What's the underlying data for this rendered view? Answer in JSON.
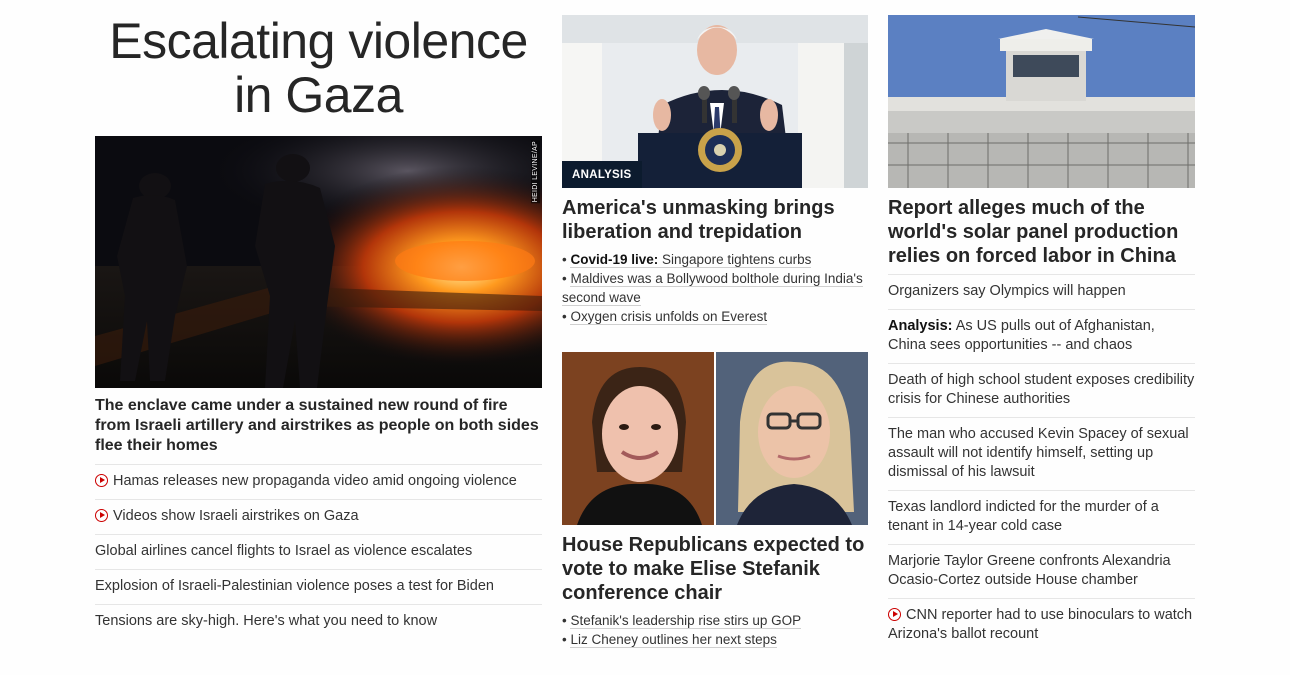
{
  "zone": {
    "title": "Escalating violence in Gaza",
    "hero": {
      "credit": "HEIDI LEVINE/AP",
      "caption": "The enclave came under a sustained new round of fire from Israeli artillery and airstrikes as people on both sides flee their homes"
    },
    "links": [
      {
        "text": "Hamas releases new propaganda video amid ongoing violence",
        "video": true
      },
      {
        "text": "Videos show Israeli airstrikes on Gaza",
        "video": true
      },
      {
        "text": "Global airlines cancel flights to Israel as violence escalates",
        "video": false
      },
      {
        "text": "Explosion of Israeli-Palestinian violence poses a test for Biden",
        "video": false
      },
      {
        "text": "Tensions are sky-high. Here's what you need to know",
        "video": false
      }
    ]
  },
  "middle": {
    "story1": {
      "badge": "ANALYSIS",
      "headline": "America's unmasking brings liberation and trepidation",
      "sublinks": [
        {
          "bold": "Covid-19 live:",
          "text": "Singapore tightens curbs"
        },
        {
          "bold": "",
          "text": "Maldives was a Bollywood bolthole during India's second wave"
        },
        {
          "bold": "",
          "text": "Oxygen crisis unfolds on Everest"
        }
      ]
    },
    "story2": {
      "headline": "House Republicans expected to vote to make Elise Stefanik conference chair",
      "sublinks": [
        {
          "text": "Stefanik's leadership rise stirs up GOP"
        },
        {
          "text": "Liz Cheney outlines her next steps"
        }
      ]
    }
  },
  "right": {
    "headline": "Report alleges much of the world's solar panel production relies on forced labor in China",
    "links": [
      {
        "bold": "",
        "text": "Organizers say Olympics will happen",
        "video": false
      },
      {
        "bold": "Analysis:",
        "text": "As US pulls out of Afghanistan, China sees opportunities -- and chaos",
        "video": false
      },
      {
        "bold": "",
        "text": "Death of high school student exposes credibility crisis for Chinese authorities",
        "video": false
      },
      {
        "bold": "",
        "text": "The man who accused Kevin Spacey of sexual assault will not identify himself, setting up dismissal of his lawsuit",
        "video": false
      },
      {
        "bold": "",
        "text": "Texas landlord indicted for the murder of a tenant in 14-year cold case",
        "video": false
      },
      {
        "bold": "",
        "text": "Marjorie Taylor Greene confronts Alexandria Ocasio-Cortez outside House chamber",
        "video": false
      },
      {
        "bold": "",
        "text": "CNN reporter had to use binoculars to watch Arizona's ballot recount",
        "video": true
      }
    ]
  },
  "colors": {
    "video_icon": "#cc0000",
    "badge_bg": "#0c1b2e",
    "divider": "#e6e6e6"
  }
}
